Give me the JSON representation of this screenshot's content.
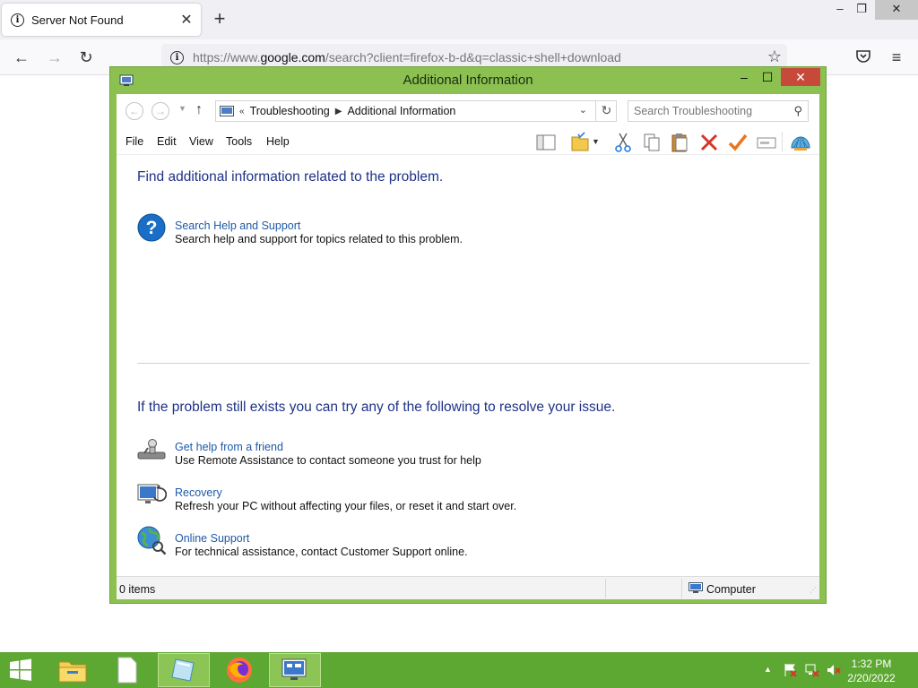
{
  "browser": {
    "tab": {
      "title": "Server Not Found"
    },
    "url": {
      "prefix": "https://www.",
      "domain": "google.com",
      "path": "/search?client=firefox-b-d&q=classic+shell+download"
    }
  },
  "window": {
    "title": "Additional Information",
    "breadcrumb": [
      "Troubleshooting",
      "Additional Information"
    ],
    "search_placeholder": "Search Troubleshooting",
    "menu": [
      "File",
      "Edit",
      "View",
      "Tools",
      "Help"
    ],
    "heading1": "Find additional information related to the problem.",
    "heading2": "If the problem still exists you can try any of the following to resolve your issue.",
    "tasks": [
      {
        "icon": "help-icon",
        "link": "Search Help and Support",
        "desc": "Search help and support for topics related to this problem."
      },
      {
        "icon": "remote-assistance-icon",
        "link": "Get help from a friend",
        "desc": "Use Remote Assistance to contact someone you trust for help"
      },
      {
        "icon": "recovery-icon",
        "link": "Recovery",
        "desc": "Refresh your PC without affecting your files, or reset it and start over."
      },
      {
        "icon": "globe-icon",
        "link": "Online Support",
        "desc": "For technical assistance, contact Customer Support online."
      }
    ],
    "status": {
      "items": "0 items",
      "location": "Computer"
    }
  },
  "taskbar": {
    "time": "1:32 PM",
    "date": "2/20/2022"
  },
  "colors": {
    "window_frame": "#8cc152",
    "taskbar": "#5da832",
    "link": "#1e5aa8",
    "heading": "#1e3287"
  }
}
